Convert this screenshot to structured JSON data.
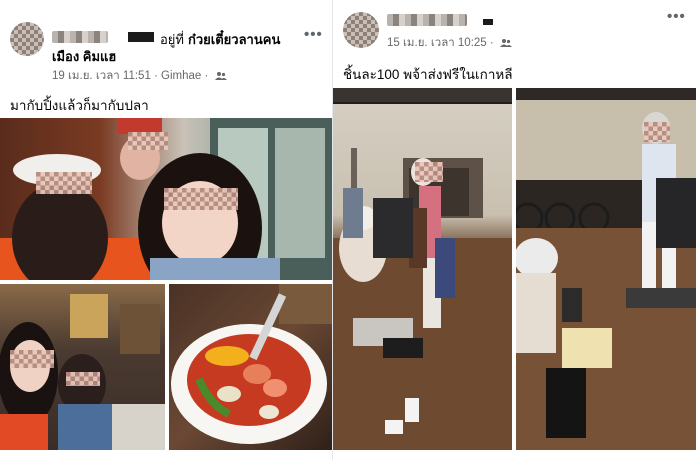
{
  "left_post": {
    "checkin_prefix": "อยู่ที่",
    "place": "ก๋วยเตี๋ยวลานคน",
    "location_name": "เมือง คิมแฮ",
    "meta": "19 เม.ย. เวลา 11:51 · Gimhae ·",
    "caption": "มากับปิ้งแล้วก็มากับปลา",
    "more": "•••"
  },
  "right_post": {
    "meta": "15 เม.ย. เวลา 10:25 ·",
    "caption": "ชิ้นละ100 พจ้าส่งฟรีในเกาหลี",
    "more": "•••"
  },
  "icons": {
    "privacy": "friends-icon",
    "options": "more-options-icon"
  },
  "colors": {
    "meta_text": "#65676b",
    "primary_text": "#050505",
    "divider": "#e4e6eb"
  }
}
